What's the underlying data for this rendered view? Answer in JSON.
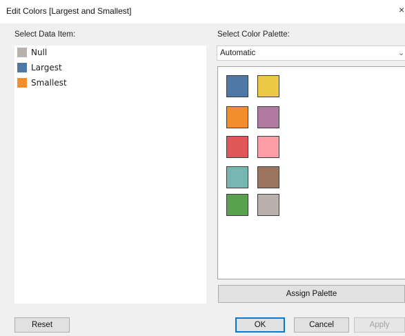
{
  "window": {
    "title": "Edit Colors [Largest and Smallest]",
    "close_glyph": "×"
  },
  "left_panel": {
    "label": "Select Data Item:",
    "items": [
      {
        "label": "Null",
        "color": "#bab0ac"
      },
      {
        "label": "Largest",
        "color": "#4e79a7"
      },
      {
        "label": "Smallest",
        "color": "#f28e2b"
      }
    ]
  },
  "right_panel": {
    "label": "Select Color Palette:",
    "palette_select": {
      "value": "Automatic",
      "icon": "chevron-down-icon"
    },
    "palette_colors": [
      "#4e79a7",
      "#edc948",
      "#f28e2b",
      "#b07aa1",
      "#e15759",
      "#ff9da7",
      "#76b7b2",
      "#9c755f",
      "#59a14f",
      "#bab0ac"
    ],
    "assign_palette_label": "Assign Palette"
  },
  "buttons": {
    "reset": "Reset",
    "ok": "OK",
    "cancel": "Cancel",
    "apply": "Apply"
  }
}
